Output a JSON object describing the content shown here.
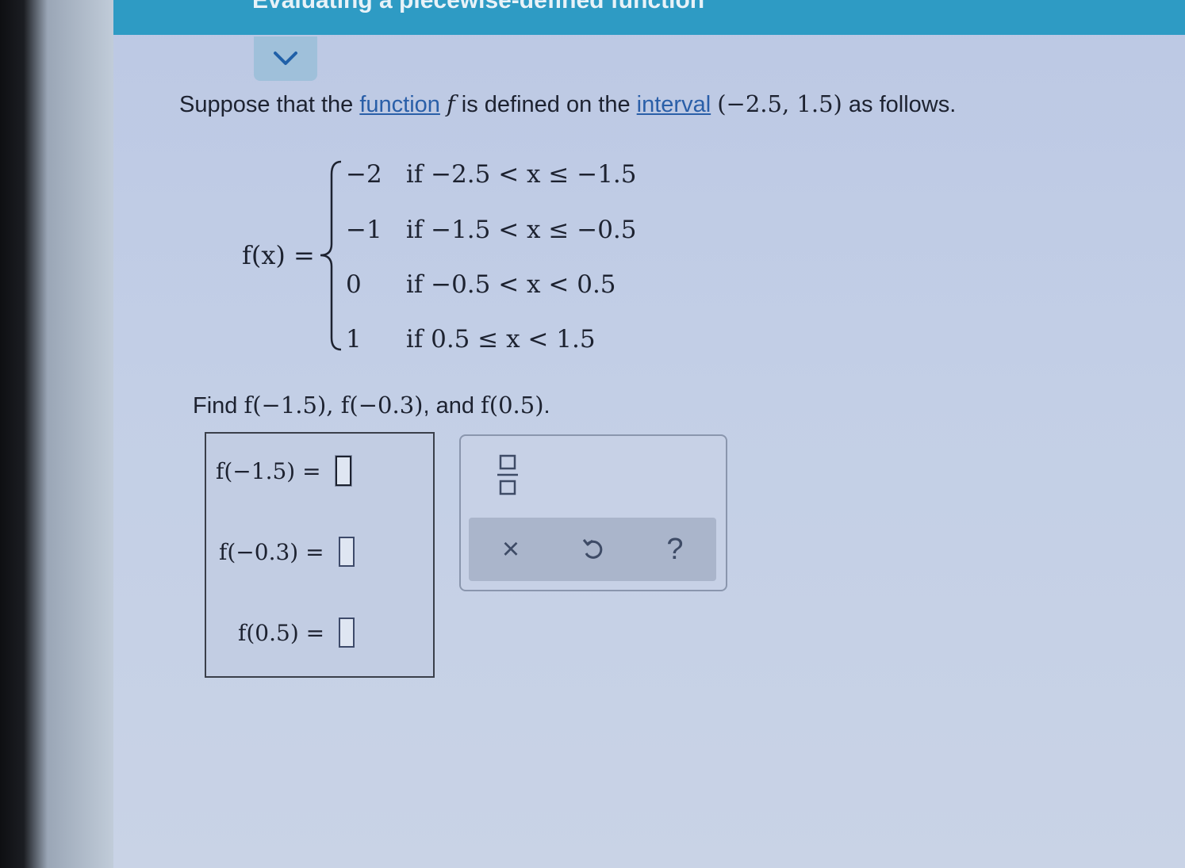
{
  "header": {
    "title": "Evaluating a piecewise-defined function"
  },
  "problem": {
    "intro_prefix": "Suppose that the ",
    "link_function": "function",
    "intro_mid1": " is defined on the ",
    "link_interval": "interval",
    "interval": "(−2.5,  1.5)",
    "intro_suffix": " as follows.",
    "fn_var": "f",
    "fn_label": "f(x) =",
    "cases": [
      {
        "value": "−2",
        "condition": "if −2.5 < x ≤ −1.5"
      },
      {
        "value": "−1",
        "condition": "if −1.5 < x ≤ −0.5"
      },
      {
        "value": "0",
        "condition": "if −0.5 < x < 0.5"
      },
      {
        "value": "1",
        "condition": "if 0.5 ≤ x < 1.5"
      }
    ],
    "find_prefix": "Find ",
    "find_expr1": "f(−1.5), f(−0.3)",
    "find_mid": ", and ",
    "find_expr2": "f(0.5)",
    "find_suffix": "."
  },
  "answers": [
    {
      "label": "f(−1.5) =",
      "value": ""
    },
    {
      "label": "f(−0.3) =",
      "value": ""
    },
    {
      "label": "f(0.5) =",
      "value": ""
    }
  ],
  "keypad": {
    "fraction_icon": "fraction-icon",
    "clear_label": "×",
    "undo_icon": "undo-icon",
    "help_label": "?"
  },
  "colors": {
    "header": "#2e9bc4",
    "link": "#2a5fa8",
    "toolbar": "#aab5cb"
  }
}
